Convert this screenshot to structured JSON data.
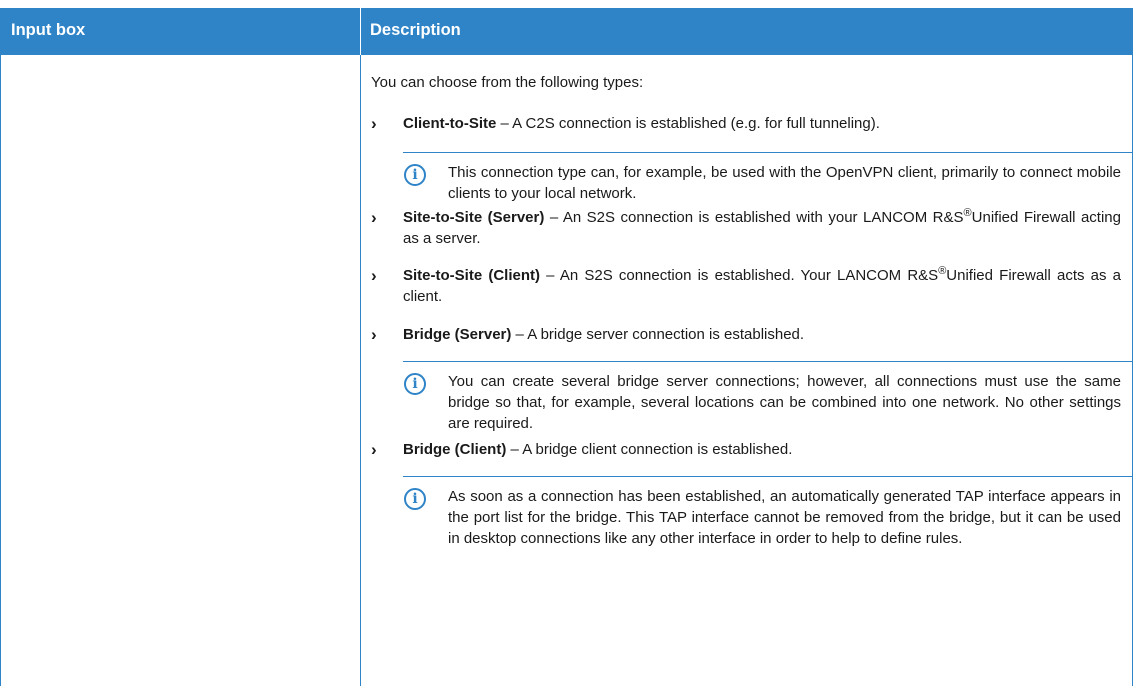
{
  "header": {
    "col1": "Input box",
    "col2": "Description"
  },
  "description": {
    "intro": "You can choose from the following types:",
    "items": [
      {
        "title": "Client-to-Site",
        "text": " – A C2S connection is established (e.g. for full tunneling)."
      },
      {
        "title": "Site-to-Site (Server)",
        "text_a": " – An S2S connection is established with your LANCOM R&S",
        "sup": "®",
        "text_b": "Unified Firewall acting as a server."
      },
      {
        "title": "Site-to-Site (Client)",
        "text_a": " – An S2S connection is established. Your LANCOM R&S",
        "sup": "®",
        "text_b": "Unified Firewall acts as a client."
      },
      {
        "title": "Bridge (Server)",
        "text": " – A bridge server connection is established."
      },
      {
        "title": "Bridge (Client)",
        "text": " – A bridge client connection is established."
      }
    ],
    "notes": [
      "This connection type can, for example, be used with the OpenVPN client, primarily to connect mobile clients to your local network.",
      "You can create several bridge server connections; however, all connections must use the same bridge so that, for example, several locations can be combined into one network. No other settings are required.",
      "As soon as a connection has been established, an automatically generated TAP interface appears in the port list for the bridge. This TAP interface cannot be removed from the bridge, but it can be used in desktop connections like any other interface in order to help to define rules."
    ],
    "info_icon": "info-circle-icon",
    "bullet_icon": "chevron-right-icon"
  },
  "colors": {
    "accent": "#2f84c8",
    "text": "#1a1a1a"
  }
}
